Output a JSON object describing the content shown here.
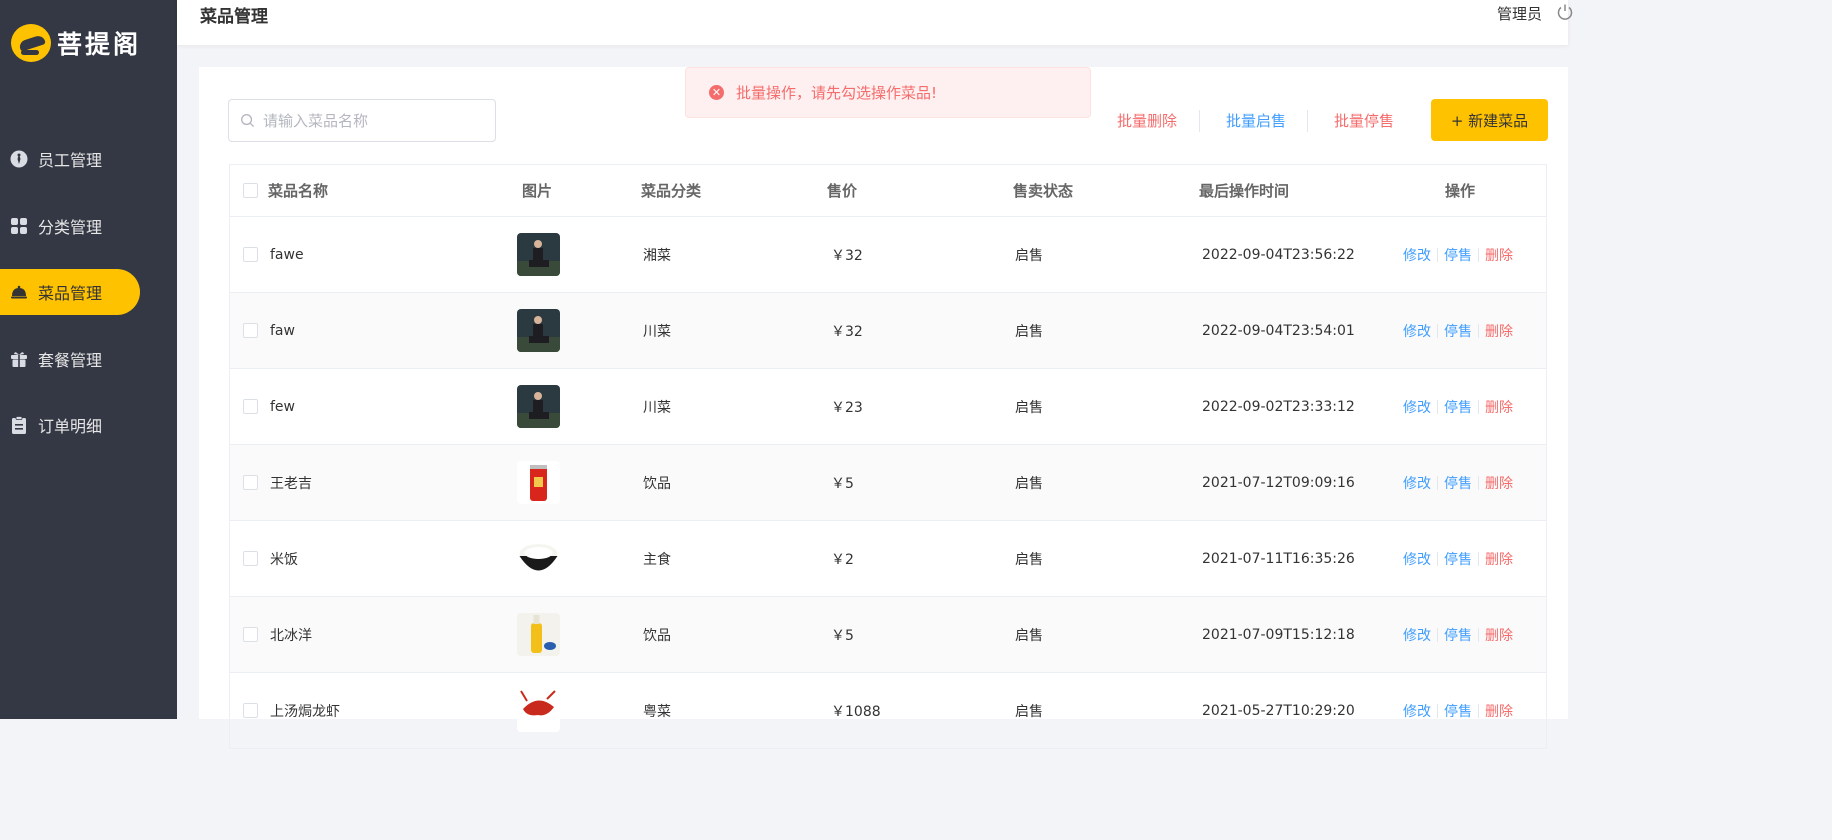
{
  "sidebar": {
    "logo_text": "菩提阁",
    "items": [
      {
        "label": "员工管理",
        "icon": "staff-icon",
        "active": false
      },
      {
        "label": "分类管理",
        "icon": "category-grid-icon",
        "active": false
      },
      {
        "label": "菜品管理",
        "icon": "dish-cloche-icon",
        "active": true
      },
      {
        "label": "套餐管理",
        "icon": "gift-icon",
        "active": false
      },
      {
        "label": "订单明细",
        "icon": "clipboard-icon",
        "active": false
      }
    ]
  },
  "header": {
    "title": "菜品管理",
    "user": "管理员"
  },
  "toolbar": {
    "search_placeholder": "请输入菜品名称",
    "toast": "批量操作，请先勾选操作菜品!",
    "batch_delete": "批量删除",
    "batch_enable": "批量启售",
    "batch_disable": "批量停售",
    "new_button": "+ 新建菜品"
  },
  "table": {
    "headers": {
      "name": "菜品名称",
      "image": "图片",
      "category": "菜品分类",
      "price": "售价",
      "status": "售卖状态",
      "updated": "最后操作时间",
      "actions": "操作"
    },
    "rows": [
      {
        "name": "fawe",
        "image": "person-photo",
        "category": "湘菜",
        "price": "￥32",
        "status": "启售",
        "updated": "2022-09-04T23:56:22",
        "edit": "修改",
        "toggle": "停售",
        "delete": "删除"
      },
      {
        "name": "faw",
        "image": "person-photo",
        "category": "川菜",
        "price": "￥32",
        "status": "启售",
        "updated": "2022-09-04T23:54:01",
        "edit": "修改",
        "toggle": "停售",
        "delete": "删除"
      },
      {
        "name": "few",
        "image": "person-photo",
        "category": "川菜",
        "price": "￥23",
        "status": "启售",
        "updated": "2022-09-02T23:33:12",
        "edit": "修改",
        "toggle": "停售",
        "delete": "删除"
      },
      {
        "name": "王老吉",
        "image": "red-can-photo",
        "category": "饮品",
        "price": "￥5",
        "status": "启售",
        "updated": "2021-07-12T09:09:16",
        "edit": "修改",
        "toggle": "停售",
        "delete": "删除"
      },
      {
        "name": "米饭",
        "image": "rice-bowl-photo",
        "category": "主食",
        "price": "￥2",
        "status": "启售",
        "updated": "2021-07-11T16:35:26",
        "edit": "修改",
        "toggle": "停售",
        "delete": "删除"
      },
      {
        "name": "北冰洋",
        "image": "soda-bottle-photo",
        "category": "饮品",
        "price": "￥5",
        "status": "启售",
        "updated": "2021-07-09T15:12:18",
        "edit": "修改",
        "toggle": "停售",
        "delete": "删除"
      },
      {
        "name": "上汤焗龙虾",
        "image": "lobster-photo",
        "category": "粤菜",
        "price": "￥1088",
        "status": "启售",
        "updated": "2021-05-27T10:29:20",
        "edit": "修改",
        "toggle": "停售",
        "delete": "删除"
      }
    ]
  },
  "colors": {
    "sidebar_bg": "#343744",
    "accent": "#ffc200",
    "link_blue": "#419eff",
    "danger_red": "#f56c6c"
  }
}
